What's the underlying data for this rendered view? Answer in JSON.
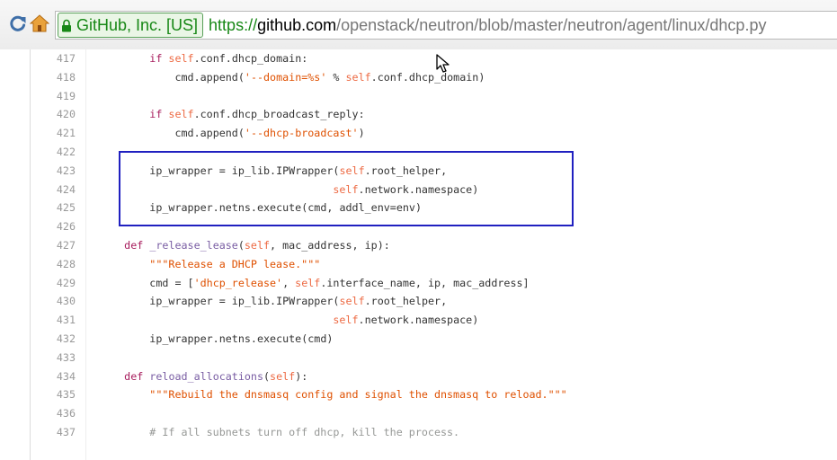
{
  "browser": {
    "ev_org": "GitHub, Inc. [US]",
    "url": {
      "scheme": "https://",
      "host": "github.com",
      "path": "/openstack/neutron/blob/master/neutron/agent/linux/dhcp.py"
    },
    "icons": [
      "reload-icon",
      "home-icon",
      "lock-icon"
    ]
  },
  "code": {
    "lines": [
      {
        "num": "417",
        "text": "        if self.conf.dhcp_domain:"
      },
      {
        "num": "418",
        "text": "            cmd.append('--domain=%s' % self.conf.dhcp_domain)"
      },
      {
        "num": "419",
        "text": ""
      },
      {
        "num": "420",
        "text": "        if self.conf.dhcp_broadcast_reply:"
      },
      {
        "num": "421",
        "text": "            cmd.append('--dhcp-broadcast')"
      },
      {
        "num": "422",
        "text": ""
      },
      {
        "num": "423",
        "text": "        ip_wrapper = ip_lib.IPWrapper(self.root_helper,"
      },
      {
        "num": "424",
        "text": "                                     self.network.namespace)"
      },
      {
        "num": "425",
        "text": "        ip_wrapper.netns.execute(cmd, addl_env=env)"
      },
      {
        "num": "426",
        "text": ""
      },
      {
        "num": "427",
        "text": "    def _release_lease(self, mac_address, ip):"
      },
      {
        "num": "428",
        "text": "        \"\"\"Release a DHCP lease.\"\"\""
      },
      {
        "num": "429",
        "text": "        cmd = ['dhcp_release', self.interface_name, ip, mac_address]"
      },
      {
        "num": "430",
        "text": "        ip_wrapper = ip_lib.IPWrapper(self.root_helper,"
      },
      {
        "num": "431",
        "text": "                                     self.network.namespace)"
      },
      {
        "num": "432",
        "text": "        ip_wrapper.netns.execute(cmd)"
      },
      {
        "num": "433",
        "text": ""
      },
      {
        "num": "434",
        "text": "    def reload_allocations(self):"
      },
      {
        "num": "435",
        "text": "        \"\"\"Rebuild the dnsmasq config and signal the dnsmasq to reload.\"\"\""
      },
      {
        "num": "436",
        "text": ""
      },
      {
        "num": "437",
        "text": "        # If all subnets turn off dhcp, kill the process."
      }
    ]
  },
  "colors": {
    "keyword": "#a71d5d",
    "string": "#df5000",
    "self": "#ed6a43",
    "function": "#795da3",
    "comment": "#969896",
    "text": "#333333",
    "line_number": "#999999",
    "highlight_box": "#2020c0",
    "secure_green": "#178816"
  }
}
